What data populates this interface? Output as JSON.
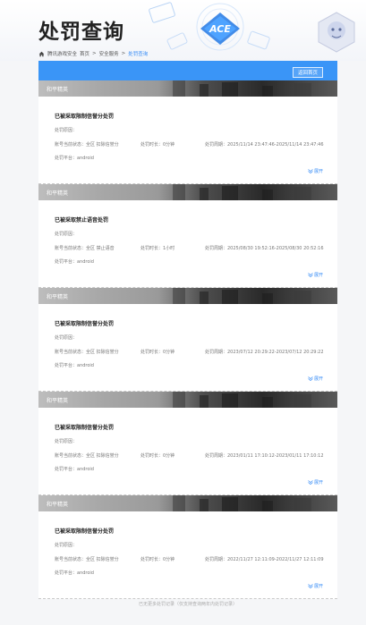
{
  "header": {
    "title": "处罚查询",
    "logo_text": "ACE",
    "mascot_icon": "mascot-icon"
  },
  "breadcrumb": {
    "items": [
      "腾讯游戏安全",
      "首页",
      "安全服务"
    ],
    "separator": ">",
    "active": "处罚查询"
  },
  "panel": {
    "back_label": "返回首页",
    "accent_color": "#3a95f7"
  },
  "records": [
    {
      "banner_label": "和平精英",
      "title": "已被采取限制信誉分处罚",
      "reason": "处罚原因：",
      "status": "账号当前状态：全区 扣除信誉分",
      "duration": "处罚时长：0分钟",
      "period": "处罚周期：2025/11/14 23:47:46-2025/11/14 23:47:46",
      "platform": "处罚平台：android",
      "expand_label": "展开"
    },
    {
      "banner_label": "和平精英",
      "title": "已被采取禁止语音处罚",
      "reason": "处罚原因：",
      "status": "账号当前状态：全区 禁止语音",
      "duration": "处罚时长：1小时",
      "period": "处罚周期：2025/08/30 19:52:16-2025/08/30 20:52:16",
      "platform": "处罚平台：android",
      "expand_label": "展开"
    },
    {
      "banner_label": "和平精英",
      "title": "已被采取限制信誉分处罚",
      "reason": "处罚原因：",
      "status": "账号当前状态：全区 扣除信誉分",
      "duration": "处罚时长：0分钟",
      "period": "处罚周期：2023/07/12 20:29:22-2023/07/12 20:29:22",
      "platform": "处罚平台：android",
      "expand_label": "展开"
    },
    {
      "banner_label": "和平精英",
      "title": "已被采取限制信誉分处罚",
      "reason": "处罚原因：",
      "status": "账号当前状态：全区 扣除信誉分",
      "duration": "处罚时长：0分钟",
      "period": "处罚周期：2023/01/11 17:10:12-2023/01/11 17:10:12",
      "platform": "处罚平台：android",
      "expand_label": "展开"
    },
    {
      "banner_label": "和平精英",
      "title": "已被采取限制信誉分处罚",
      "reason": "处罚原因：",
      "status": "账号当前状态：全区 扣除信誉分",
      "duration": "处罚时长：0分钟",
      "period": "处罚周期：2022/11/27 12:11:09-2022/11/27 12:11:09",
      "platform": "处罚平台：android",
      "expand_label": "展开"
    }
  ],
  "footer": {
    "note": "已无更多处罚记录（仅支持查询两年内处罚记录）"
  }
}
